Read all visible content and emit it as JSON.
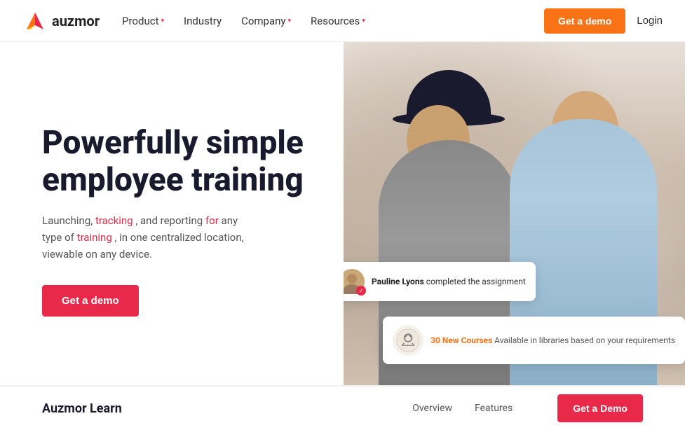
{
  "logo": {
    "text": "auzmor"
  },
  "navbar": {
    "links": [
      {
        "label": "Product",
        "hasDropdown": true
      },
      {
        "label": "Industry",
        "hasDropdown": false
      },
      {
        "label": "Company",
        "hasDropdown": true
      },
      {
        "label": "Resources",
        "hasDropdown": true
      }
    ],
    "cta_label": "Get a demo",
    "login_label": "Login"
  },
  "hero": {
    "title": "Powerfully simple employee training",
    "subtitle_part1": "Launching, ",
    "subtitle_tracking": "tracking",
    "subtitle_part2": ", and reporting ",
    "subtitle_for": "for",
    "subtitle_part3": " any type of ",
    "subtitle_training": "training",
    "subtitle_part4": ", in one centralized location, viewable on any device.",
    "cta_label": "Get a demo"
  },
  "notification1": {
    "name": "Pauline Lyons",
    "action": " completed the assignment"
  },
  "notification2": {
    "courses_count": "30 New Courses",
    "text": " Available in libraries based on your requirements"
  },
  "bottom_bar": {
    "brand": "Auzmor Learn",
    "links": [
      {
        "label": "Overview"
      },
      {
        "label": "Features"
      }
    ],
    "cta_label": "Get a Demo"
  }
}
